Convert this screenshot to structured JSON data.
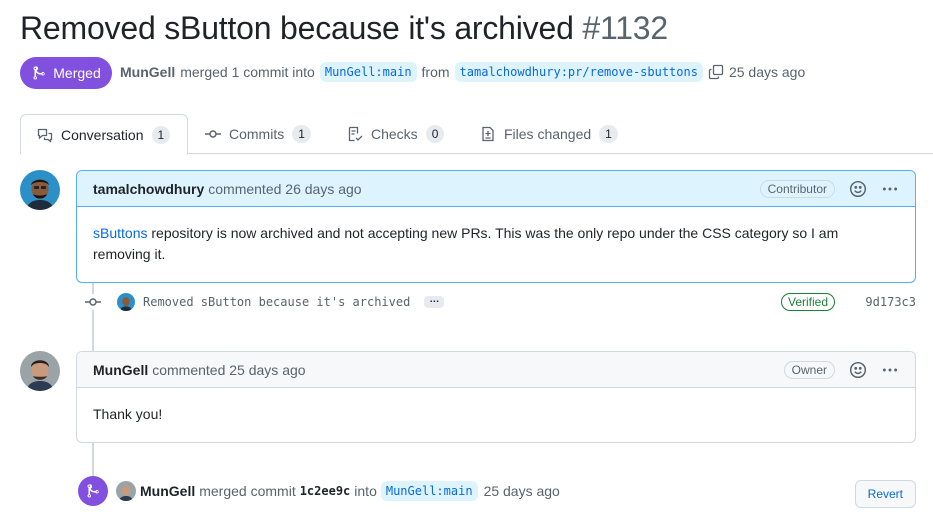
{
  "pr": {
    "title": "Removed sButton because it's archived",
    "number": "#1132",
    "state": "Merged",
    "author": "MunGell",
    "merged_text": "merged 1 commit into",
    "base_branch": "MunGell:main",
    "from_text": "from",
    "head_branch": "tamalchowdhury:pr/remove-sbuttons",
    "time_ago": "25 days ago"
  },
  "tabs": [
    {
      "label": "Conversation",
      "count": "1",
      "icon": "comment-discussion-icon"
    },
    {
      "label": "Commits",
      "count": "1",
      "icon": "git-commit-icon"
    },
    {
      "label": "Checks",
      "count": "0",
      "icon": "checklist-icon"
    },
    {
      "label": "Files changed",
      "count": "1",
      "icon": "file-diff-icon"
    }
  ],
  "comment1": {
    "author": "tamalchowdhury",
    "action": "commented 26 days ago",
    "role": "Contributor",
    "link_text": "sButtons",
    "body": " repository is now archived and not accepting new PRs. This was the only repo under the CSS category so I am removing it."
  },
  "commit": {
    "message": "Removed sButton because it's archived",
    "expand_label": "…",
    "verified": "Verified",
    "sha": "9d173c3"
  },
  "comment2": {
    "author": "MunGell",
    "action": "commented 25 days ago",
    "role": "Owner",
    "body": "Thank you!"
  },
  "merge_event": {
    "author": "MunGell",
    "text1": "merged commit",
    "sha": "1c2ee9c",
    "text2": "into",
    "branch": "MunGell:main",
    "time": "25 days ago",
    "revert_label": "Revert"
  },
  "colors": {
    "merged_purple": "#8250df",
    "link_blue": "#0969da",
    "verified_green": "#1a7f37"
  }
}
